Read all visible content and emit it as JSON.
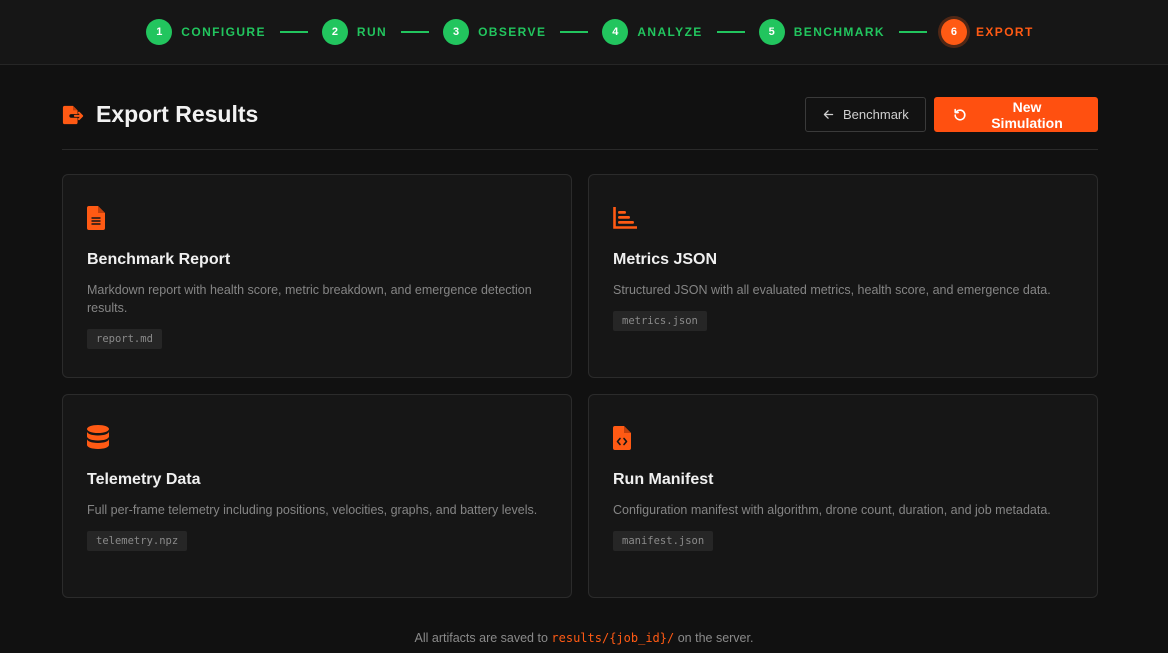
{
  "stepper": {
    "steps": [
      {
        "num": "1",
        "label": "CONFIGURE"
      },
      {
        "num": "2",
        "label": "RUN"
      },
      {
        "num": "3",
        "label": "OBSERVE"
      },
      {
        "num": "4",
        "label": "ANALYZE"
      },
      {
        "num": "5",
        "label": "BENCHMARK"
      },
      {
        "num": "6",
        "label": "EXPORT"
      }
    ],
    "active_step": "6"
  },
  "header": {
    "title": "Export Results",
    "back_button_label": "Benchmark",
    "primary_button_label": "New Simulation"
  },
  "cards": [
    {
      "icon": "file-text-icon",
      "title": "Benchmark Report",
      "description": "Markdown report with health score, metric breakdown, and emergence detection results.",
      "file": "report.md"
    },
    {
      "icon": "bar-chart-icon",
      "title": "Metrics JSON",
      "description": "Structured JSON with all evaluated metrics, health score, and emergence data.",
      "file": "metrics.json"
    },
    {
      "icon": "database-icon",
      "title": "Telemetry Data",
      "description": "Full per-frame telemetry including positions, velocities, graphs, and battery levels.",
      "file": "telemetry.npz"
    },
    {
      "icon": "file-code-icon",
      "title": "Run Manifest",
      "description": "Configuration manifest with algorithm, drone count, duration, and job metadata.",
      "file": "manifest.json"
    }
  ],
  "footer": {
    "prefix": "All artifacts are saved to",
    "path": "results/{job_id}/",
    "suffix": "on the server."
  },
  "colors": {
    "accent": "#ff5a14",
    "success": "#22c55e",
    "background": "#111111",
    "card": "#161616"
  }
}
